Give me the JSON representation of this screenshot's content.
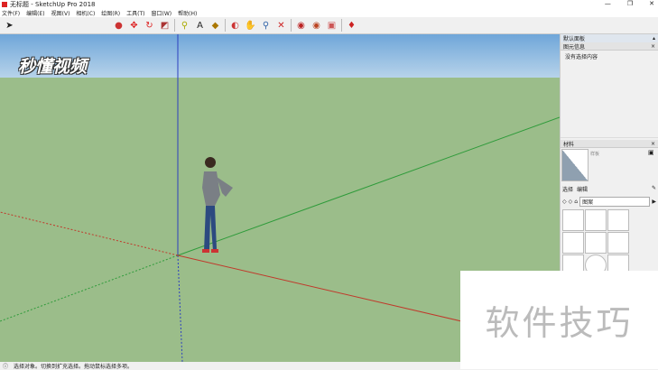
{
  "title": "无标题 - SketchUp Pro 2018",
  "window_controls": [
    "—",
    "❐",
    "✕"
  ],
  "menu": [
    "文件(F)",
    "编辑(E)",
    "视图(V)",
    "相机(C)",
    "绘图(R)",
    "工具(T)",
    "窗口(W)",
    "帮助(H)"
  ],
  "logo_text": "秒懂视频",
  "watermark": "软件技巧",
  "panel": {
    "title": "默认面板",
    "entity_info": "图元信息",
    "no_selection": "没有选择内容",
    "materials": "材料",
    "material_name": "样板",
    "tab_select": "选择",
    "tab_edit": "编辑",
    "library": "图案"
  },
  "status": [
    "选择对象。切换到扩充选择。拖动鼠标选择多项。"
  ],
  "colors": {
    "ground": "#9bbd8a",
    "sky": "#6fa6d9",
    "red_axis": "#c0392b",
    "green_axis": "#2e9b3a",
    "blue_axis": "#2c3fbf"
  }
}
